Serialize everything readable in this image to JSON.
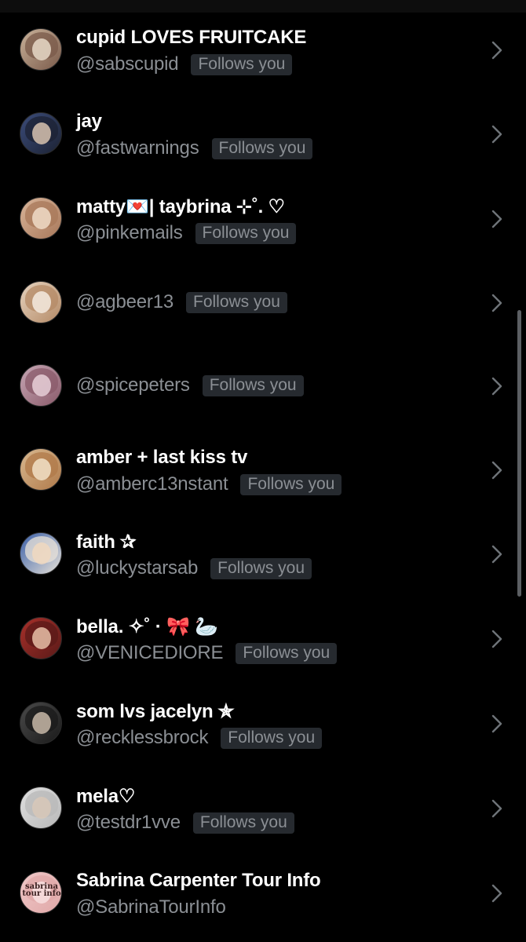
{
  "followers": [
    {
      "name": "cupid LOVES FRUITCAKE",
      "handle": "@sabscupid",
      "badge": "Follows you",
      "avatar_colors": [
        "#c9b29a",
        "#7a5a4a",
        "#e8d9c8"
      ]
    },
    {
      "name": "jay",
      "handle": "@fastwarnings",
      "badge": "Follows you",
      "avatar_colors": [
        "#3b4c7a",
        "#1c2233",
        "#d8c3b0"
      ]
    },
    {
      "name": "matty💌| taybrina ⊹˚. ♡",
      "handle": "@pinkemails",
      "badge": "Follows you",
      "avatar_colors": [
        "#d9b59a",
        "#a8785a",
        "#f0dcc8"
      ]
    },
    {
      "name": "",
      "handle": "@agbeer13",
      "badge": "Follows you",
      "avatar_colors": [
        "#e6d3bf",
        "#b48a66",
        "#f5ebe0"
      ]
    },
    {
      "name": "",
      "handle": "@spicepeters",
      "badge": "Follows you",
      "avatar_colors": [
        "#c7a7b5",
        "#8a5a6a",
        "#e8d0d8"
      ]
    },
    {
      "name": "amber + last kiss tv",
      "handle": "@amberc13nstant",
      "badge": "Follows you",
      "avatar_colors": [
        "#d8b890",
        "#b07a4a",
        "#f2e2c8"
      ]
    },
    {
      "name": "faith ✰",
      "handle": "@luckystarsab",
      "badge": "Follows you",
      "avatar_colors": [
        "#3a5fa8",
        "#e8e2d8",
        "#f0d8c0"
      ]
    },
    {
      "name": "bella. ✧˚ · 🎀 🦢",
      "handle": "@VENICEDIORE",
      "badge": "Follows you",
      "avatar_colors": [
        "#a8302a",
        "#5a1a18",
        "#e8c0a8"
      ]
    },
    {
      "name": "som lvs jacelyn ✯",
      "handle": "@recklessbrock",
      "badge": "Follows you",
      "avatar_colors": [
        "#4a4a4a",
        "#1a1a1a",
        "#c8b8a8"
      ]
    },
    {
      "name": "mela♡",
      "handle": "@testdr1vve",
      "badge": "Follows you",
      "avatar_colors": [
        "#e0e0e0",
        "#b8b8b8",
        "#d8c8b8"
      ]
    },
    {
      "name": "Sabrina Carpenter Tour Info",
      "handle": "@SabrinaTourInfo",
      "badge": "",
      "avatar_colors": [
        "#f0c8c8",
        "#e0a8a8",
        "#f8e0e0"
      ],
      "avatar_text": "sabrina tour info"
    }
  ],
  "colors": {
    "background": "#000000",
    "name": "#ffffff",
    "handle": "#8b8f94",
    "badge_bg": "#262a2f",
    "chevron": "#6e7378"
  },
  "icons": {
    "chevron": "chevron-right-icon"
  }
}
